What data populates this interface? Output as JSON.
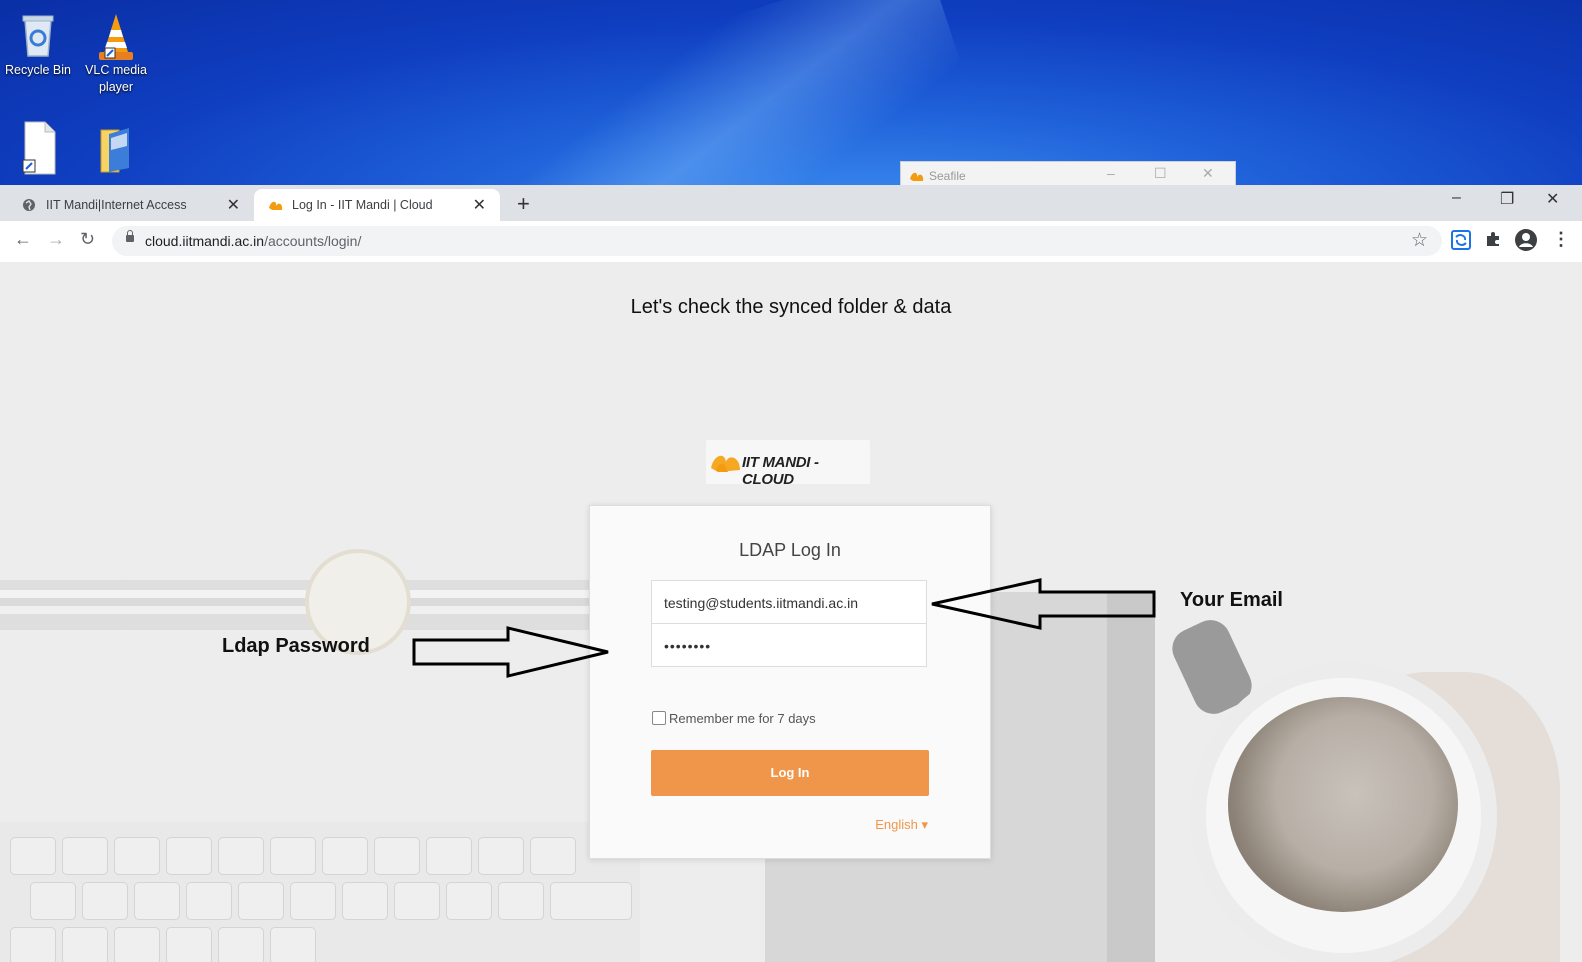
{
  "desktop": {
    "icons": [
      {
        "label": "Recycle Bin",
        "icon": "recycle-bin-icon"
      },
      {
        "label": "VLC media player",
        "icon": "vlc-cone-icon"
      },
      {
        "label": "",
        "icon": "document-shortcut-icon"
      },
      {
        "label": "",
        "icon": "folder-icon"
      }
    ],
    "background_window": {
      "title": "Seafile"
    }
  },
  "browser": {
    "tabs": [
      {
        "label": "IIT Mandi|Internet Access",
        "active": false
      },
      {
        "label": "Log In - IIT Mandi | Cloud",
        "active": true
      }
    ],
    "url_host": "cloud.iitmandi.ac.in",
    "url_path": "/accounts/login/"
  },
  "page": {
    "headline": "Let's check the synced folder & data",
    "logo_text": "IIT MANDI - CLOUD",
    "login": {
      "title": "LDAP Log In",
      "email_value": "testing@students.iitmandi.ac.in",
      "password_value": "••••••••",
      "remember_label": "Remember me for 7 days",
      "submit_label": "Log In",
      "language": "English ▾"
    },
    "annotations": {
      "email": "Your Email",
      "password": "Ldap Password"
    }
  },
  "colors": {
    "accent": "#f0964a",
    "desktop_blue": "#1e5fd8",
    "tabstrip": "#dee1e6"
  }
}
